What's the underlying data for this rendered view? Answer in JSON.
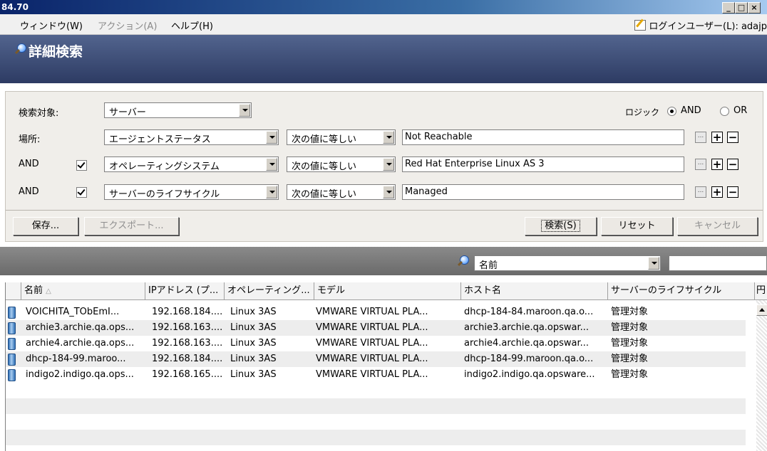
{
  "window": {
    "title": "84.70"
  },
  "menubar": {
    "window_menu": "ウィンドウ(W)",
    "action_menu": "アクション(A)",
    "help_menu": "ヘルプ(H)",
    "login_user": "ログインユーザー(L): adajp"
  },
  "header": {
    "title": "詳細検索"
  },
  "criteria": {
    "target_label": "検索対象:",
    "target_value": "サーバー",
    "logic_label": "ロジック",
    "logic_and": "AND",
    "logic_or": "OR",
    "logic_selected": "AND",
    "rows": [
      {
        "prefix": "場所:",
        "checked": null,
        "field": "エージェントステータス",
        "operator": "次の値に等しい",
        "value": "Not Reachable"
      },
      {
        "prefix": "AND",
        "checked": true,
        "field": "オペレーティングシステム",
        "operator": "次の値に等しい",
        "value": "Red Hat Enterprise Linux AS 3"
      },
      {
        "prefix": "AND",
        "checked": true,
        "field": "サーバーのライフサイクル",
        "operator": "次の値に等しい",
        "value": "Managed"
      }
    ],
    "buttons": {
      "save": "保存...",
      "export": "エクスポート...",
      "search": "検索(S)",
      "reset": "リセット",
      "cancel": "キャンセル"
    },
    "ellipsis": "...",
    "plus": "+",
    "minus": "−"
  },
  "results": {
    "filter_field": "名前",
    "filter_text": "",
    "columns": [
      "名前",
      "IPアドレス (プ...",
      "オペレーティング...",
      "モデル",
      "ホスト名",
      "サーバーのライフサイクル",
      "円"
    ],
    "sorted_column": "名前",
    "rows": [
      [
        "VOICHITA_TObEmI...",
        "192.168.184....",
        "Linux 3AS",
        "VMWARE VIRTUAL PLA...",
        "dhcp-184-84.maroon.qa.o...",
        "管理対象"
      ],
      [
        "archie3.archie.qa.ops...",
        "192.168.163....",
        "Linux 3AS",
        "VMWARE VIRTUAL PLA...",
        "archie3.archie.qa.opswar...",
        "管理対象"
      ],
      [
        "archie4.archie.qa.ops...",
        "192.168.163....",
        "Linux 3AS",
        "VMWARE VIRTUAL PLA...",
        "archie4.archie.qa.opswar...",
        "管理対象"
      ],
      [
        "dhcp-184-99.maroo...",
        "192.168.184....",
        "Linux 3AS",
        "VMWARE VIRTUAL PLA...",
        "dhcp-184-99.maroon.qa.o...",
        "管理対象"
      ],
      [
        "indigo2.indigo.qa.ops...",
        "192.168.165....",
        "Linux 3AS",
        "VMWARE VIRTUAL PLA...",
        "indigo2.indigo.qa.opsware...",
        "管理対象"
      ]
    ]
  }
}
